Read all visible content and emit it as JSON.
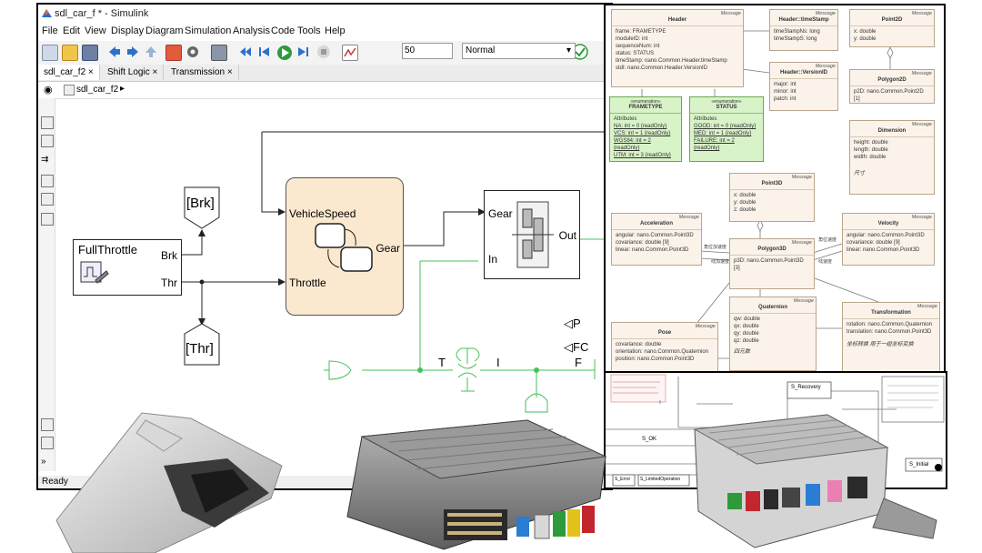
{
  "window": {
    "title": "sdl_car_f * - Simulink",
    "menu": [
      "File",
      "Edit",
      "View",
      "Display",
      "Diagram",
      "Simulation",
      "Analysis",
      "Code",
      "Tools",
      "Help"
    ],
    "stop_time": "50",
    "sim_mode": "Normal",
    "tabs": [
      "sdl_car_f2",
      "Shift Logic",
      "Transmission"
    ],
    "breadcrumb": "sdl_car_f2",
    "status": "Ready"
  },
  "model": {
    "full_throttle": {
      "title": "FullThrottle",
      "out1": "Brk",
      "out2": "Thr"
    },
    "goto_brk": "[Brk]",
    "goto_thr": "[Thr]",
    "shift_logic": {
      "in1": "VehicleSpeed",
      "in2": "Throttle",
      "out": "Gear"
    },
    "transmission": {
      "in1": "Gear",
      "in2": "In",
      "out": "Out"
    },
    "ports": {
      "p": "P",
      "fc": "FC",
      "t": "T",
      "i": "I",
      "f": "F"
    }
  },
  "uml": {
    "stereotype": "Message",
    "enum_stereotype": "«enumeration»",
    "attributes_label": "Attributes",
    "header": {
      "name": "Header",
      "attrs": [
        "frame: FRAMETYPE",
        "moduleID: int",
        "sequenceNum: int",
        "status: STATUS",
        "timeStamp: nano.Common.Header.timeStamp",
        "stdI: nano.Common.Header.VersionID"
      ]
    },
    "timestamp": {
      "name": "Header::timeStamp",
      "attrs": [
        "timeStampNs: long",
        "timeStampS: long"
      ]
    },
    "point2d": {
      "name": "Point2D",
      "attrs": [
        "x: double",
        "y: double"
      ]
    },
    "versionid": {
      "name": "Header::VersionID",
      "attrs": [
        "major: int",
        "minor: int",
        "patch: int"
      ]
    },
    "polygon2d": {
      "name": "Polygon2D",
      "attrs": [
        "p2D: nano.Common.Point2D [1]"
      ]
    },
    "frametype": {
      "name": "FRAMETYPE",
      "attrs": [
        "NA: int = 0 {readOnly}",
        "VCS: int = 1 {readOnly}",
        "WGS84: int = 2 {readOnly}",
        "UTM: int = 3 {readOnly}"
      ]
    },
    "status": {
      "name": "STATUS",
      "attrs": [
        "GOOD: int = 0 {readOnly}",
        "MED: int = 1 {readOnly}",
        "FAILURE: int = 2 {readOnly}"
      ]
    },
    "dimension": {
      "name": "Dimension",
      "attrs": [
        "height: double",
        "length: double",
        "width: double"
      ],
      "note": "尺寸"
    },
    "point3d": {
      "name": "Point3D",
      "attrs": [
        "x: double",
        "y: double",
        "z: double"
      ]
    },
    "acceleration": {
      "name": "Acceleration",
      "attrs": [
        "angular: nano.Common.Point3D",
        "covariance: double [9]",
        "linear: nano.Common.Point3D"
      ]
    },
    "polygon3d": {
      "name": "Polygon3D",
      "attrs": [
        "p3D: nano.Common.Point3D [3]"
      ]
    },
    "velocity": {
      "name": "Velocity",
      "attrs": [
        "angular: nano.Common.Point3D",
        "covariance: double [9]",
        "linear: nano.Common.Point3D"
      ]
    },
    "quaternion": {
      "name": "Quaternion",
      "attrs": [
        "qw: double",
        "qx: double",
        "qy: double",
        "qz: double"
      ],
      "note": "四元数"
    },
    "pose": {
      "name": "Pose",
      "attrs": [
        "covariance: double",
        "orientation: nano.Common.Quaternion",
        "position: nano.Common.Point3D"
      ]
    },
    "transformation": {
      "name": "Transformation",
      "attrs": [
        "rotation: nano.Common.Quaternion",
        "translation: nano.Common.Point3D"
      ],
      "note": "坐标转换 用于一组坐标变换"
    },
    "edge_labels": [
      "角位加速度",
      "线加速度",
      "角位速度",
      "线速度"
    ]
  },
  "statemachine": {
    "states": [
      "S_Recovery",
      "S_OK",
      "S_Initial"
    ],
    "boxes": [
      "S_LimitedOperation",
      "S_Error"
    ]
  },
  "colors": {
    "stateflow_fill": "#fbe9cf",
    "physical_line": "#46c25a",
    "uml_class_fill": "#fbf3ea",
    "uml_enum_fill": "#d8f3c8",
    "play_green": "#2e9a3a"
  }
}
